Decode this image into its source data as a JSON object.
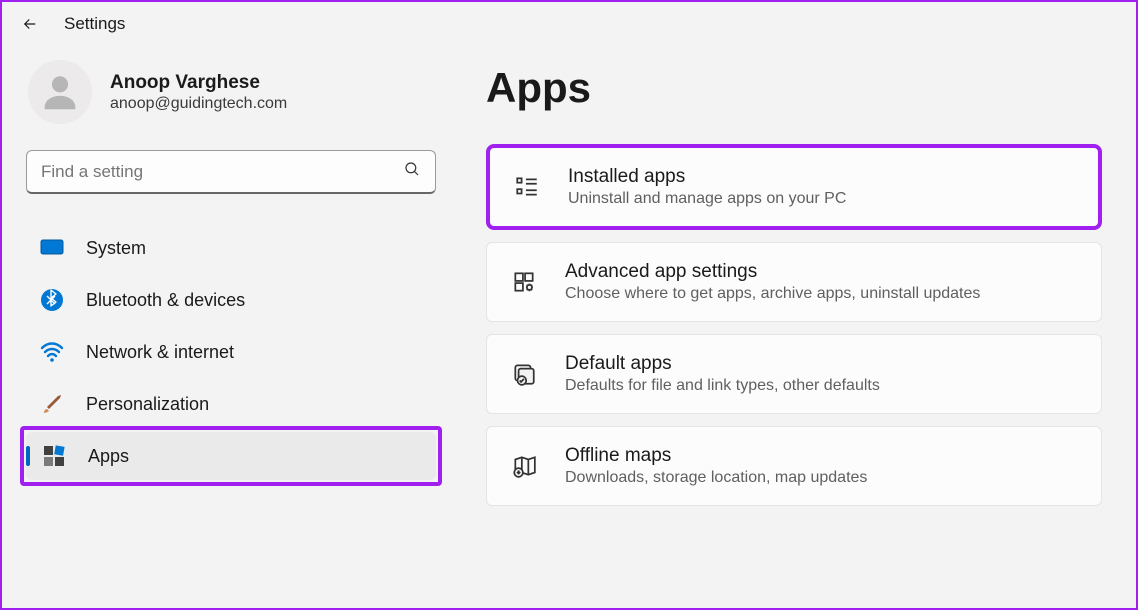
{
  "header": {
    "title": "Settings"
  },
  "profile": {
    "name": "Anoop Varghese",
    "email": "anoop@guidingtech.com"
  },
  "search": {
    "placeholder": "Find a setting"
  },
  "nav": {
    "system": "System",
    "bluetooth": "Bluetooth & devices",
    "network": "Network & internet",
    "personalization": "Personalization",
    "apps": "Apps"
  },
  "main": {
    "title": "Apps",
    "cards": {
      "installed": {
        "title": "Installed apps",
        "desc": "Uninstall and manage apps on your PC"
      },
      "advanced": {
        "title": "Advanced app settings",
        "desc": "Choose where to get apps, archive apps, uninstall updates"
      },
      "default": {
        "title": "Default apps",
        "desc": "Defaults for file and link types, other defaults"
      },
      "offline": {
        "title": "Offline maps",
        "desc": "Downloads, storage location, map updates"
      }
    }
  }
}
